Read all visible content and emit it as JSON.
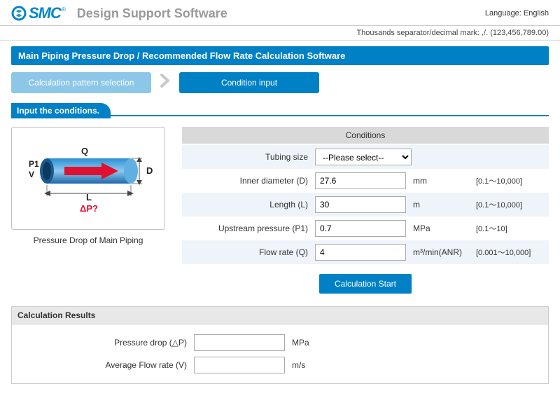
{
  "header": {
    "logo_text": "SMC",
    "support_title": "Design Support Software",
    "language_label": "Language:",
    "language_value": "English",
    "separator_note": "Thousands separator/decimal mark: ,/. (123,456,789.00)"
  },
  "page": {
    "title": "Main Piping Pressure Drop / Recommended Flow Rate Calculation Software",
    "step1": "Calculation pattern selection",
    "step2": "Condition input",
    "section_label": "Input the conditions."
  },
  "diagram": {
    "caption": "Pressure Drop of Main Piping",
    "Q": "Q",
    "D": "D",
    "P1": "P1",
    "V": "V",
    "L": "L",
    "dP": "ΔP?"
  },
  "conditions": {
    "header": "Conditions",
    "rows": [
      {
        "label": "Tubing size",
        "value": "--Please select--",
        "unit": "",
        "range": ""
      },
      {
        "label": "Inner diameter (D)",
        "value": "27.6",
        "unit": "mm",
        "range": "[0.1～10,000]"
      },
      {
        "label": "Length (L)",
        "value": "30",
        "unit": "m",
        "range": "[0.1～10,000]"
      },
      {
        "label": "Upstream pressure (P1)",
        "value": "0.7",
        "unit": "MPa",
        "range": "[0.1～10]"
      },
      {
        "label": "Flow rate (Q)",
        "value": "4",
        "unit": "m³/min(ANR)",
        "range": "[0.001～10,000]"
      }
    ],
    "calc_button": "Calculation Start"
  },
  "results": {
    "title": "Calculation Results",
    "rows": [
      {
        "label": "Pressure drop (△P)",
        "value": "",
        "unit": "MPa"
      },
      {
        "label": "Average Flow rate (V)",
        "value": "",
        "unit": "m/s"
      }
    ]
  }
}
